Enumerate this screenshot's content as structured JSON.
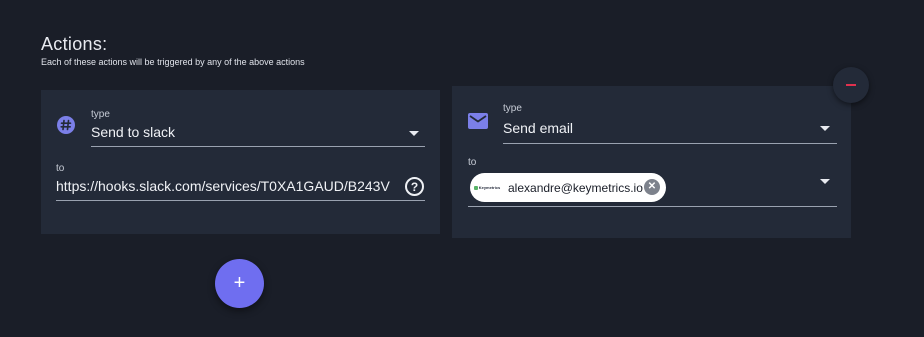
{
  "section": {
    "title": "Actions:",
    "subtitle": "Each of these actions will be triggered by any of the above actions"
  },
  "actions": [
    {
      "icon": "slack-hash-icon",
      "type_label": "type",
      "type_value": "Send to slack",
      "to_label": "to",
      "to_value": "https://hooks.slack.com/services/T0XA1GAUD/B243V",
      "help_icon_glyph": "?"
    },
    {
      "icon": "mail-icon",
      "type_label": "type",
      "type_value": "Send email",
      "to_label": "to",
      "recipient_chip": {
        "logo_text": "Keymetrics",
        "email": "alexandre@keymetrics.io"
      }
    }
  ],
  "buttons": {
    "add_glyph": "+",
    "remove_glyph": "−"
  },
  "colors": {
    "background": "#1a1e28",
    "card": "#232a38",
    "accent": "#6f6ef0",
    "danger": "#e0314e",
    "icon_purple": "#7b7fe8"
  }
}
